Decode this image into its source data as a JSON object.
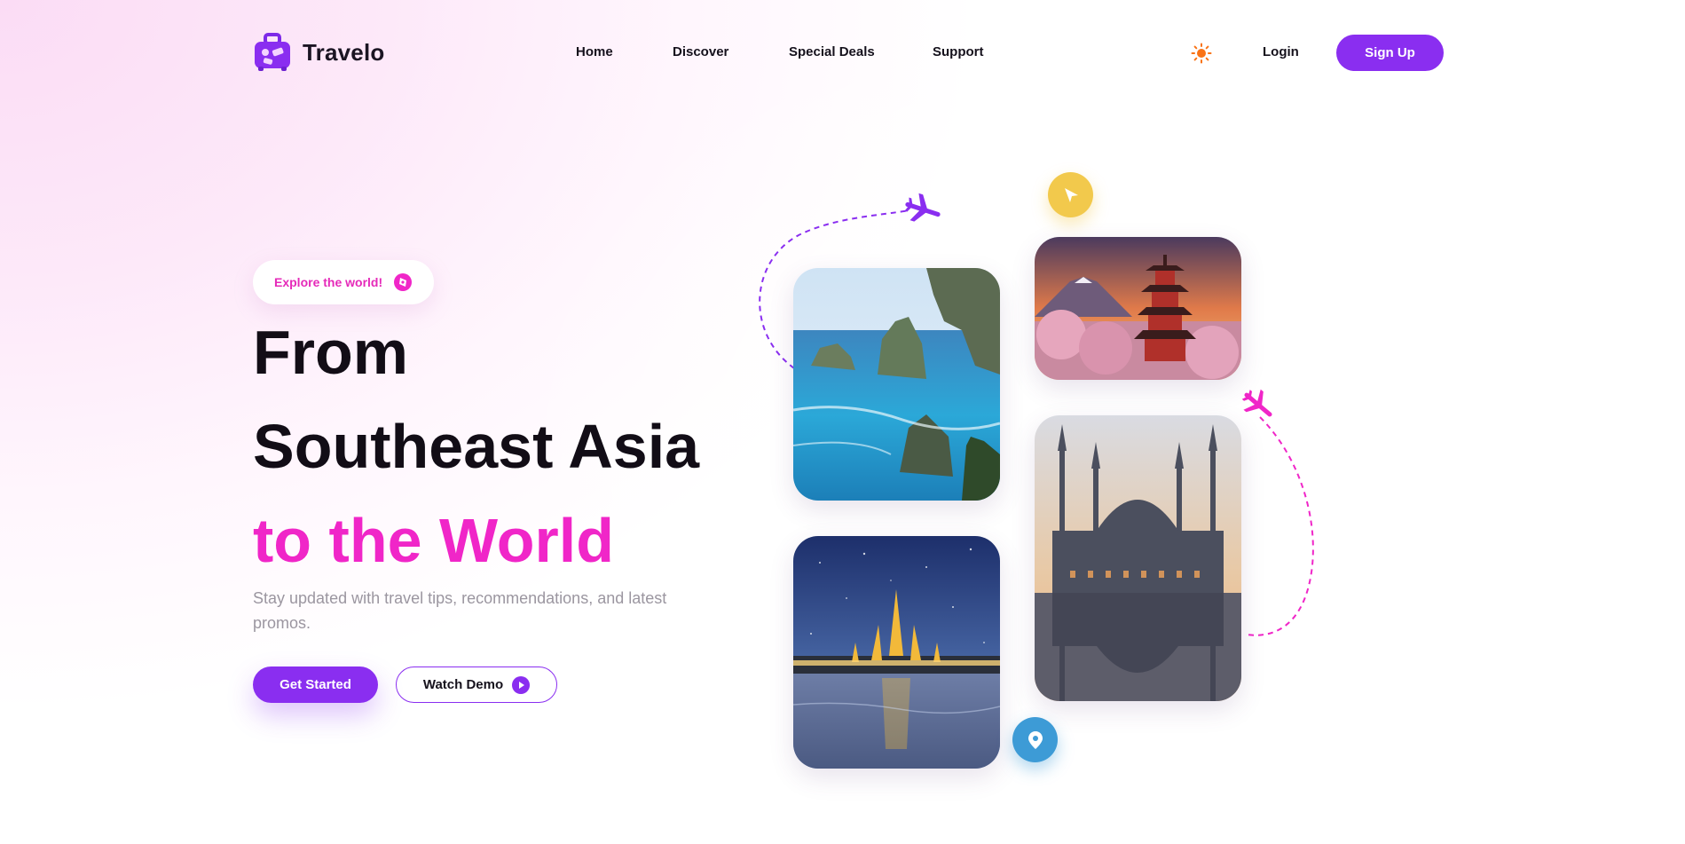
{
  "brand": {
    "name": "Travelo",
    "accent": "#8a2ef0",
    "pink": "#f026c8"
  },
  "nav": {
    "links": [
      "Home",
      "Discover",
      "Special Deals",
      "Support"
    ],
    "login": "Login",
    "signup": "Sign Up",
    "theme_icon": "sun-icon"
  },
  "hero": {
    "badge": "Explore the world!",
    "badge_icon": "compass-icon",
    "line1": "From",
    "line2": "Southeast Asia",
    "line3": "to the World",
    "subtitle": "Stay updated with travel tips, recommendations, and latest promos.",
    "cta_primary": "Get Started",
    "cta_secondary": "Watch Demo",
    "cta_secondary_icon": "play-icon"
  },
  "gallery": {
    "images": [
      "bali-cliffs-photo",
      "japan-pagoda-photo",
      "bangkok-temple-photo",
      "istanbul-mosque-photo"
    ],
    "decorations": [
      "airplane-icon",
      "navigation-arrow-icon",
      "location-pin-icon"
    ]
  }
}
